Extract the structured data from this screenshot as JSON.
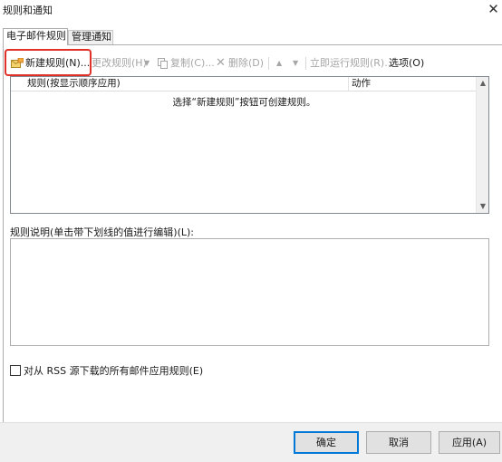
{
  "window": {
    "title": "规则和通知",
    "close_glyph": "✕"
  },
  "tabs": [
    {
      "label": "电子邮件规则",
      "active": true
    },
    {
      "label": "管理通知",
      "active": false
    }
  ],
  "toolbar": {
    "new_rule": "新建规则(N)...",
    "change_rule": "更改规则(H)",
    "copy": "复制(C)...",
    "delete": "删除(D)",
    "move_up_glyph": "▲",
    "move_down_glyph": "▼",
    "run_now": "立即运行规则(R)...",
    "options": "选项(O)"
  },
  "rules_list": {
    "columns": [
      "规则(按显示顺序应用)",
      "动作"
    ],
    "empty_message": "选择“新建规则”按钮可创建规则。",
    "scroll_up_glyph": "▲",
    "scroll_down_glyph": "▼"
  },
  "description": {
    "label": "规则说明(单击带下划线的值进行编辑)(L):"
  },
  "rss_checkbox": {
    "label": "对从 RSS 源下载的所有邮件应用规则(E)",
    "checked": false
  },
  "buttons": {
    "ok": "确定",
    "cancel": "取消",
    "apply": "应用(A)"
  },
  "colors": {
    "highlight": "#e03028",
    "default_button_border": "#0078d7",
    "disabled_text": "#a6a6a6"
  }
}
